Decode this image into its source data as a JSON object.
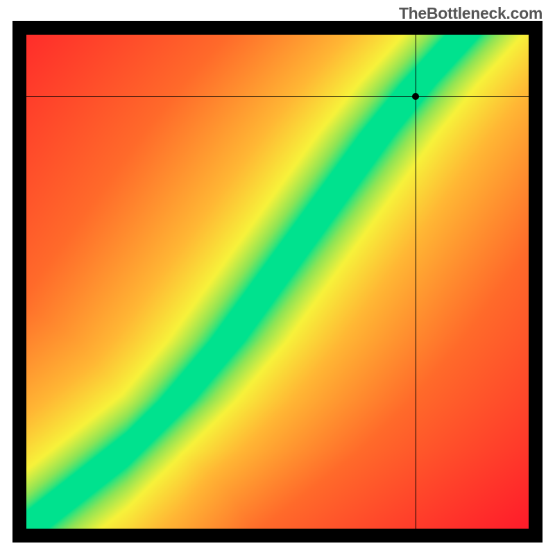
{
  "watermark": "TheBottleneck.com",
  "chart_data": {
    "type": "heatmap",
    "title": "",
    "xlabel": "",
    "ylabel": "",
    "xlim": [
      0,
      1
    ],
    "ylim": [
      0,
      1
    ],
    "colorscale": {
      "description": "red → orange → yellow → green → yellow → orange → red across distance from optimal diagonal",
      "stops": [
        {
          "t": 0.0,
          "color": "#00e28e"
        },
        {
          "t": 0.08,
          "color": "#8fe455"
        },
        {
          "t": 0.16,
          "color": "#f7f23a"
        },
        {
          "t": 0.3,
          "color": "#ffb734"
        },
        {
          "t": 0.55,
          "color": "#ff6a2a"
        },
        {
          "t": 1.0,
          "color": "#ff1b2a"
        }
      ]
    },
    "optimal_curve": {
      "description": "approximate center of green band, y as function of x (0..1, origin bottom-left)",
      "points": [
        {
          "x": 0.0,
          "y": 0.0
        },
        {
          "x": 0.1,
          "y": 0.08
        },
        {
          "x": 0.2,
          "y": 0.16
        },
        {
          "x": 0.3,
          "y": 0.26
        },
        {
          "x": 0.4,
          "y": 0.38
        },
        {
          "x": 0.5,
          "y": 0.52
        },
        {
          "x": 0.6,
          "y": 0.66
        },
        {
          "x": 0.7,
          "y": 0.8
        },
        {
          "x": 0.78,
          "y": 0.9
        },
        {
          "x": 0.87,
          "y": 1.0
        }
      ]
    },
    "band_width_fraction": 0.07,
    "crosshair": {
      "x": 0.775,
      "y": 0.875
    },
    "marker": {
      "x": 0.775,
      "y": 0.875
    },
    "annotations": []
  }
}
